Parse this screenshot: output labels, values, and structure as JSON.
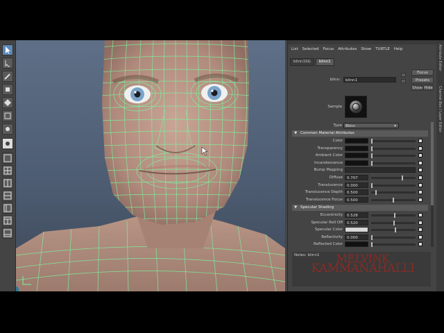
{
  "menu": [
    "List",
    "Selected",
    "Focus",
    "Attributes",
    "Show",
    "TURTLE",
    "Help"
  ],
  "tabs": [
    "blinn1SG",
    "blinn1"
  ],
  "node_label": "blinn:",
  "node_name": "blinn1",
  "buttons": {
    "focus": "Focus",
    "presets": "Presets",
    "show": "Show",
    "hide": "Hide"
  },
  "sample_label": "Sample",
  "type_label": "Type",
  "type_value": "Blinn",
  "sections": {
    "common": "Common Material Attributes",
    "specular": "Specular Shading"
  },
  "common_attrs": [
    {
      "label": "Color",
      "value": "",
      "slider": 0.0
    },
    {
      "label": "Transparency",
      "value": "",
      "slider": 0.0
    },
    {
      "label": "Ambient Color",
      "value": "",
      "slider": 0.0
    },
    {
      "label": "Incandescence",
      "value": "",
      "slider": 0.0
    },
    {
      "label": "Bump Mapping",
      "value": "",
      "slider": null
    },
    {
      "label": "Diffuse",
      "value": "0.707",
      "slider": 0.707
    },
    {
      "label": "Translucence",
      "value": "0.000",
      "slider": 0.0
    },
    {
      "label": "Translucence Depth",
      "value": "0.500",
      "slider": 0.1
    },
    {
      "label": "Translucence Focus",
      "value": "0.500",
      "slider": 0.5
    }
  ],
  "specular_attrs": [
    {
      "label": "Eccentricity",
      "value": "0.528",
      "slider": 0.528
    },
    {
      "label": "Specular Roll Off",
      "value": "0.520",
      "slider": 0.52
    },
    {
      "label": "Specular Color",
      "value": "",
      "slider": 0.55
    },
    {
      "label": "Reflectivity",
      "value": "0.000",
      "slider": 0.0
    },
    {
      "label": "Reflected Color",
      "value": "",
      "slider": 0.0
    }
  ],
  "notes_label": "Notes: blinn1",
  "side_tabs": [
    "Attribute Editor",
    "Channel Box / Layer Editor"
  ],
  "watermark": {
    "line1": "MELVINK",
    "line2": "KAMMANAHALLI"
  },
  "colors": {
    "wireframe": "#7cf5a0",
    "skin": "#b89383",
    "watermark": "#8a2a25",
    "panel": "#444444",
    "active_tool": "#5b88b6"
  },
  "tool_icons": [
    "select-arrow-icon",
    "lasso-icon",
    "paint-select-icon",
    "move-icon",
    "rotate-icon",
    "scale-icon",
    "soft-mod-icon",
    "show-manip-icon",
    "single-pane-icon",
    "four-pane-icon",
    "side-by-side-icon",
    "stacked-icon",
    "outliner-layout-icon",
    "graph-layout-icon",
    "script-editor-icon"
  ]
}
